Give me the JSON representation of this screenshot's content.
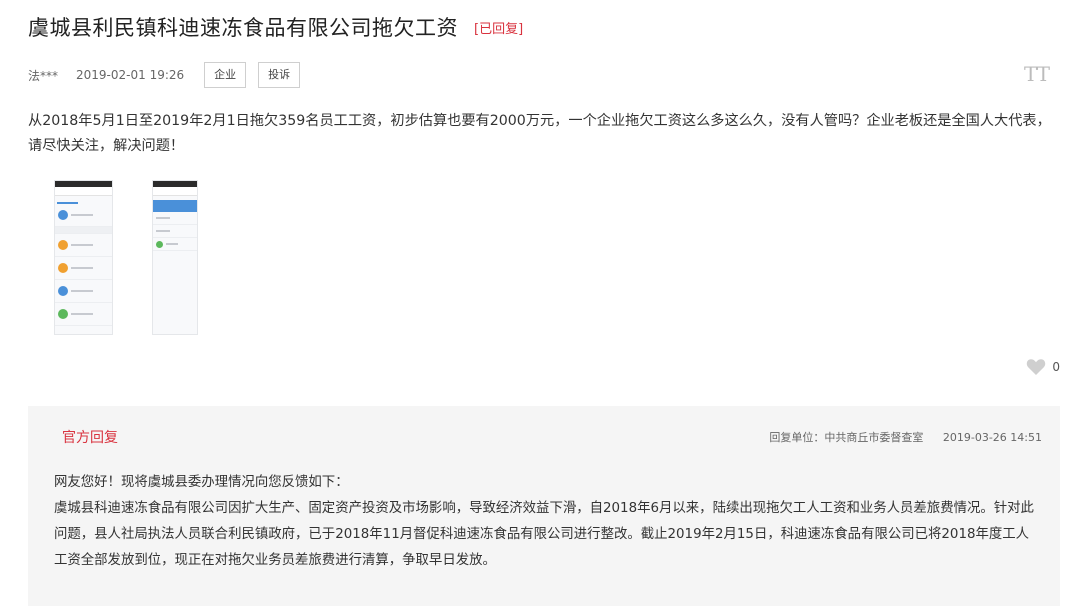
{
  "post": {
    "title": "虞城县利民镇科迪速冻食品有限公司拖欠工资",
    "status": "[已回复]",
    "author": "法***",
    "date": "2019-02-01 19:26",
    "tags": [
      "企业",
      "投诉"
    ],
    "body": "从2018年5月1日至2019年2月1日拖欠359名员工工资，初步估算也要有2000万元，一个企业拖欠工资这么多这么久，没有人管吗？企业老板还是全国人大代表，请尽快关注，解决问题！",
    "font_size_icon": "TT"
  },
  "likes": {
    "count": "0"
  },
  "reply": {
    "header": "官方回复",
    "unit": "回复单位：中共商丘市委督查室",
    "date": "2019-03-26 14:51",
    "paragraph1": "网友您好！现将虞城县委办理情况向您反馈如下：",
    "paragraph2": "虞城县科迪速冻食品有限公司因扩大生产、固定资产投资及市场影响，导致经济效益下滑，自2018年6月以来，陆续出现拖欠工人工资和业务人员差旅费情况。针对此问题，县人社局执法人员联合利民镇政府，已于2018年11月督促科迪速冻食品有限公司进行整改。截止2019年2月15日，科迪速冻食品有限公司已将2018年度工人工资全部发放到位，现正在对拖欠业务员差旅费进行清算，争取早日发放。"
  },
  "colors": {
    "accent": "#d9333f",
    "reply_bg": "#f5f5f5"
  },
  "icons": {
    "like": "heart-icon",
    "font": "font-size-icon"
  }
}
